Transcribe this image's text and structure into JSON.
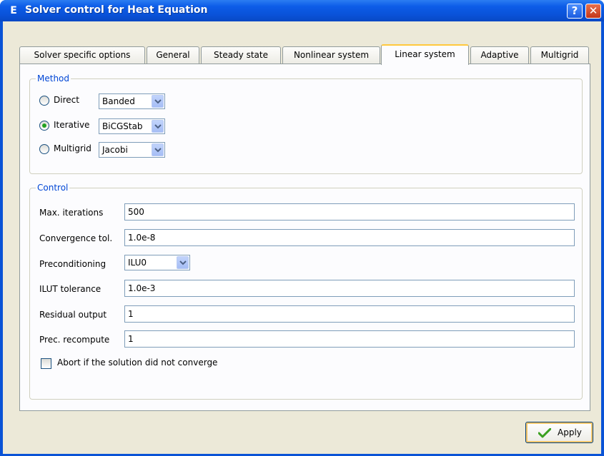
{
  "window": {
    "app_icon": "E",
    "title": "Solver control for Heat Equation",
    "help_glyph": "?",
    "close_glyph": "✕"
  },
  "tabs": [
    {
      "label": "Solver specific options",
      "active": false
    },
    {
      "label": "General",
      "active": false
    },
    {
      "label": "Steady state",
      "active": false
    },
    {
      "label": "Nonlinear system",
      "active": false
    },
    {
      "label": "Linear system",
      "active": true
    },
    {
      "label": "Adaptive",
      "active": false
    },
    {
      "label": "Multigrid",
      "active": false
    }
  ],
  "method": {
    "title": "Method",
    "options": [
      {
        "label": "Direct",
        "selected": false,
        "combo": "Banded"
      },
      {
        "label": "Iterative",
        "selected": true,
        "combo": "BiCGStab"
      },
      {
        "label": "Multigrid",
        "selected": false,
        "combo": "Jacobi"
      }
    ]
  },
  "control": {
    "title": "Control",
    "max_iterations": {
      "label": "Max. iterations",
      "value": "500"
    },
    "convergence_tol": {
      "label": "Convergence tol.",
      "value": "1.0e-8"
    },
    "preconditioning": {
      "label": "Preconditioning",
      "value": "ILU0"
    },
    "ilut_tolerance": {
      "label": "ILUT tolerance",
      "value": "1.0e-3"
    },
    "residual_output": {
      "label": "Residual output",
      "value": "1"
    },
    "prec_recompute": {
      "label": "Prec. recompute",
      "value": "1"
    },
    "abort_checkbox": {
      "label": "Abort if the solution did not converge",
      "checked": false
    }
  },
  "apply_button": {
    "label": "Apply",
    "icon": "checkmark-icon"
  },
  "colors": {
    "titlebar": "#0a52d8",
    "group_title": "#0046d5",
    "active_tab_accent": "#ffc83c",
    "dialog_bg": "#ece9d8"
  }
}
